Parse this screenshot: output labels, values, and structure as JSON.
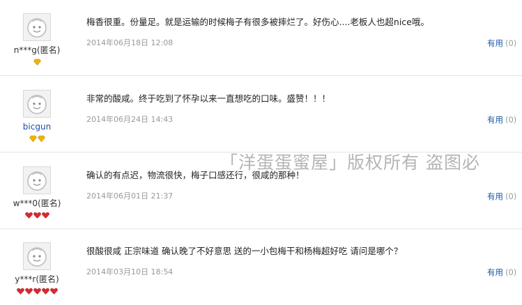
{
  "reviews": [
    {
      "user": "n***g(匿名)",
      "badge_type": "gold-diamond",
      "badge_count": 1,
      "comment": "梅香很重。份量足。就是运输的时候梅子有很多被摔烂了。好伤心....老板人也超nice哦。",
      "date": "2014年06月18日 12:08",
      "useful_label": "有用",
      "useful_count": "(0)"
    },
    {
      "user": "bicgun",
      "badge_type": "gold-diamond",
      "badge_count": 2,
      "comment": "非常的酸咸。终于吃到了怀孕以来一直想吃的口味。盛赞！！！",
      "date": "2014年06月24日 14:43",
      "useful_label": "有用",
      "useful_count": "(0)"
    },
    {
      "user": "w***0(匿名)",
      "badge_type": "red-heart",
      "badge_count": 3,
      "comment": "确认的有点迟，物流很快，梅子口感还行，很咸的那种！",
      "date": "2014年06月01日 21:37",
      "useful_label": "有用",
      "useful_count": "(0)"
    },
    {
      "user": "y***r(匿名)",
      "badge_type": "red-heart",
      "badge_count": 5,
      "comment": "很酸很咸 正宗味道 确认晚了不好意思 送的一小包梅干和杨梅超好吃 请问是哪个？",
      "date": "2014年03月10日 18:54",
      "useful_label": "有用",
      "useful_count": "(0)"
    }
  ],
  "watermark": "「洋蛋蛋蜜屋」版权所有 盗图必",
  "colors": {
    "link": "#1a5aa6",
    "date": "#999999",
    "gold_badge": "#f0b400",
    "red_badge": "#d9282f",
    "divider": "#e4e4e4"
  }
}
